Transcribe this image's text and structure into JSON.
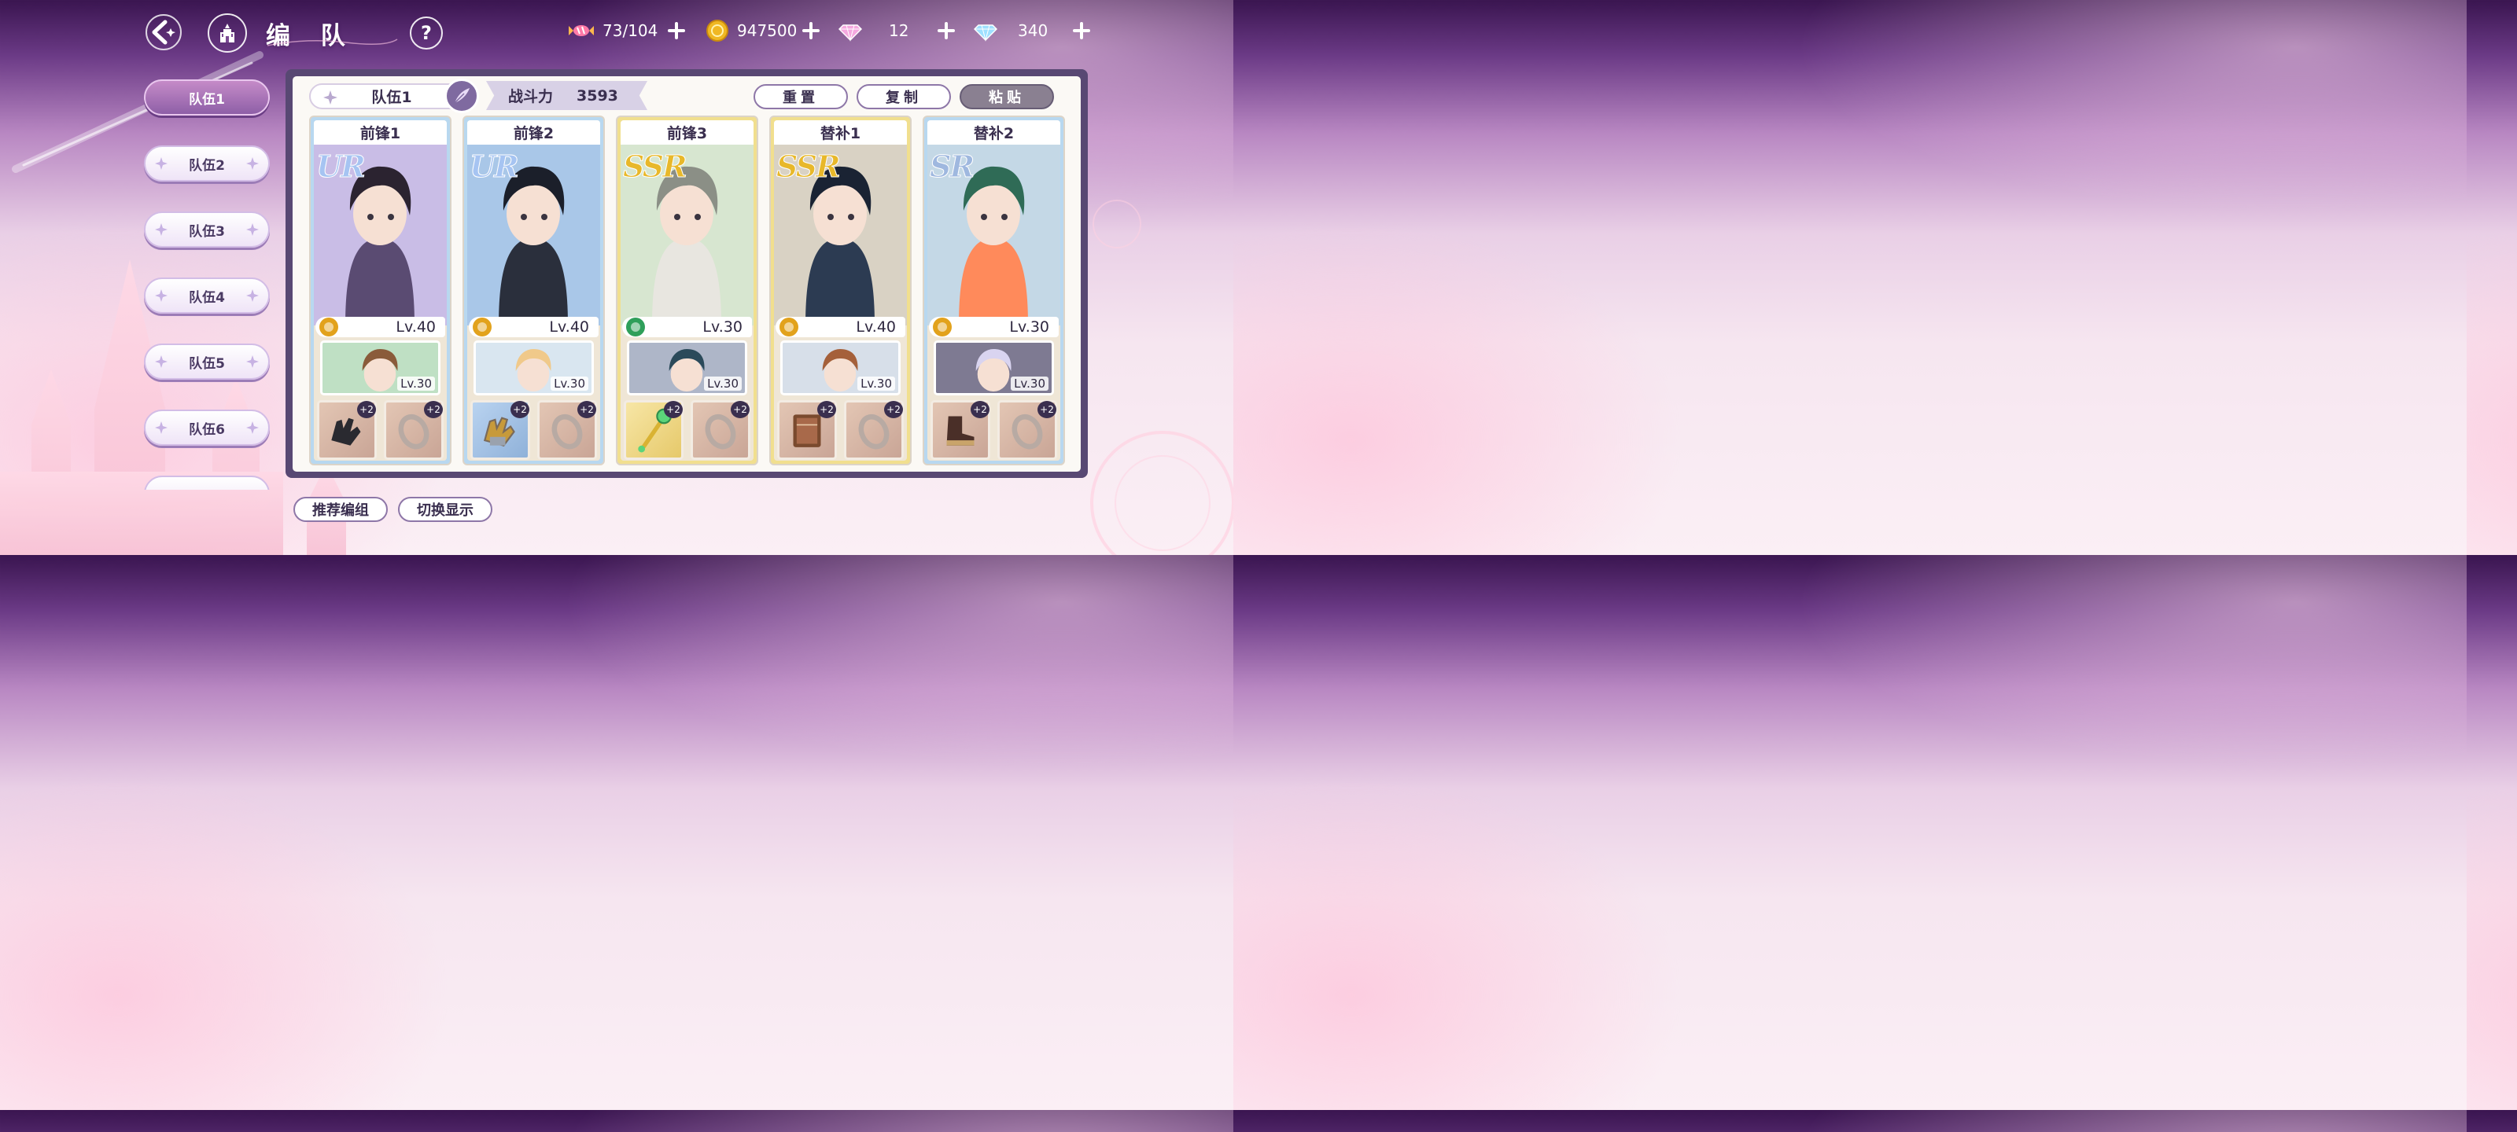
{
  "header": {
    "title": "编 队",
    "back_icon": "back-arrow-icon",
    "home_icon": "castle-home-icon",
    "help_icon": "help-icon"
  },
  "resources": [
    {
      "name": "stamina",
      "icon": "candy-icon",
      "value": "73/104"
    },
    {
      "name": "gold",
      "icon": "coin-icon",
      "value": "947500"
    },
    {
      "name": "pink-gem",
      "icon": "pink-diamond-icon",
      "value": "12"
    },
    {
      "name": "blue-gem",
      "icon": "blue-diamond-icon",
      "value": "340"
    }
  ],
  "team_tabs": [
    {
      "label": "队伍1",
      "active": true
    },
    {
      "label": "队伍2",
      "active": false
    },
    {
      "label": "队伍3",
      "active": false
    },
    {
      "label": "队伍4",
      "active": false
    },
    {
      "label": "队伍5",
      "active": false
    },
    {
      "label": "队伍6",
      "active": false
    }
  ],
  "team": {
    "name": "队伍1",
    "power_label": "战斗力",
    "power_value": "3593"
  },
  "actions": {
    "reset": "重置",
    "copy": "复制",
    "paste": "粘贴"
  },
  "cards": [
    {
      "slot": "前锋1",
      "rarity": "UR",
      "level": "Lv.40",
      "element": "fist-icon",
      "element_color": "#e2a21c",
      "sub_level": "Lv.30",
      "equip1": "glove-icon",
      "equip2": "ring-icon",
      "equip_bonus": "+2",
      "frame": "#b8d8f0",
      "rarity_color": "#a6c4f2"
    },
    {
      "slot": "前锋2",
      "rarity": "UR",
      "level": "Lv.40",
      "element": "fist-icon",
      "element_color": "#e2a21c",
      "sub_level": "Lv.30",
      "equip1": "gauntlet-icon",
      "equip2": "ring-icon",
      "equip_bonus": "+2",
      "frame": "#b8d8f0",
      "rarity_color": "#a6c4f2"
    },
    {
      "slot": "前锋3",
      "rarity": "SSR",
      "level": "Lv.30",
      "element": "wand-icon",
      "element_color": "#2f9f5a",
      "sub_level": "Lv.30",
      "equip1": "staff-icon",
      "equip2": "ring-icon",
      "equip_bonus": "+2",
      "frame": "#f1df8e",
      "rarity_color": "#e8b82a"
    },
    {
      "slot": "替补1",
      "rarity": "SSR",
      "level": "Lv.40",
      "element": "fist-icon",
      "element_color": "#e2a21c",
      "sub_level": "Lv.30",
      "equip1": "book-icon",
      "equip2": "ring-icon",
      "equip_bonus": "+2",
      "frame": "#f1df8e",
      "rarity_color": "#e8b82a"
    },
    {
      "slot": "替补2",
      "rarity": "SR",
      "level": "Lv.30",
      "element": "fist-icon",
      "element_color": "#e2a21c",
      "sub_level": "Lv.30",
      "equip1": "boot-icon",
      "equip2": "ring-icon",
      "equip_bonus": "+2",
      "frame": "#b8d8f0",
      "rarity_color": "#9fb8df"
    }
  ],
  "bottom": {
    "recommend": "推荐编组",
    "switch_view": "切换显示"
  }
}
